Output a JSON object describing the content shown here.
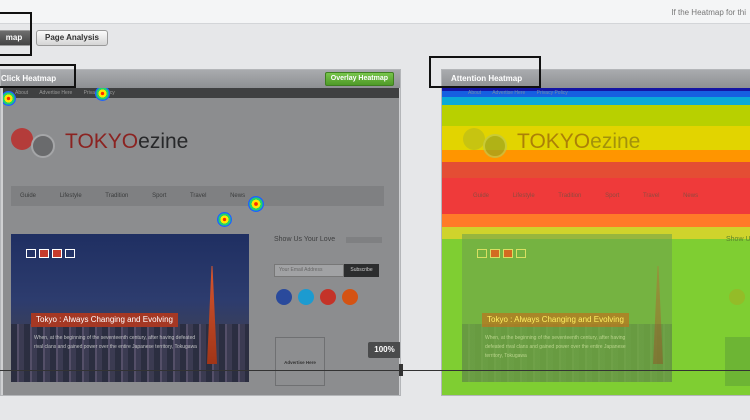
{
  "top_note": "If the Heatmap for thi",
  "tabs": [
    {
      "label": "map",
      "active": true
    },
    {
      "label": "Page Analysis",
      "active": false
    }
  ],
  "left_panel": {
    "title": "Click Heatmap",
    "overlay_button": "Overlay Heatmap",
    "zoom": "100%"
  },
  "right_panel": {
    "title": "Attention Heatmap"
  },
  "site": {
    "topbar_links": [
      "About",
      "Advertise Here",
      "Privacy Policy"
    ],
    "logo_text_accent": "TOKYO",
    "logo_text_rest": "ezine",
    "nav": [
      "Guide",
      "Lifestyle",
      "Tradition",
      "Sport",
      "Travel",
      "News"
    ],
    "hero_title": "Tokyo : Always Changing and Evolving",
    "hero_text": "When, at the beginning of the seventeenth century, after having defeated rival clans and gained power over the entire Japanese territory, Tokugawa",
    "side_title": "Show Us Your Love",
    "email_placeholder": "Your Email Address",
    "subscribe_label": "Subscribe",
    "social_colors": [
      "#2a4a9c",
      "#1c9bd0",
      "#c43328",
      "#d45313"
    ],
    "ad_label": "Advertise Here"
  },
  "click_hotspots": [
    {
      "name": "About link"
    },
    {
      "name": "Privacy Policy link"
    },
    {
      "name": "News nav item"
    },
    {
      "name": "below navigation"
    }
  ],
  "colors": {
    "overlay_button": "#5aa92f",
    "header": "#989a9d",
    "background": "#e6e7e9"
  }
}
